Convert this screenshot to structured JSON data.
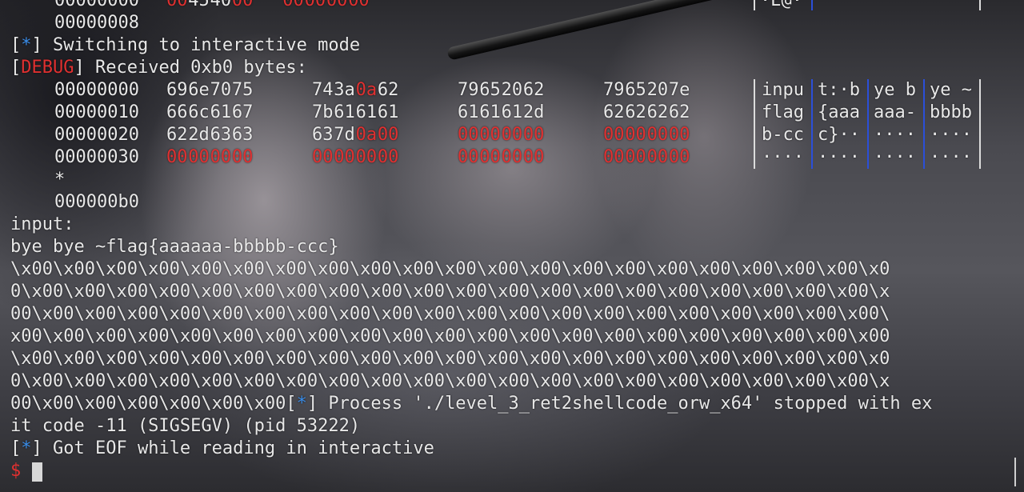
{
  "top_partial": {
    "hex_offset": "00000000",
    "hex_bytes": [
      "00",
      "45",
      "40",
      "00",
      "00",
      "00",
      "00",
      "00"
    ],
    "ascii": "·E@·",
    "next_offset": "00000008"
  },
  "lines": {
    "switching_marker": "*",
    "switching_text": " Switching to interactive mode",
    "debug_tag": "DEBUG",
    "received_text": " Received 0xb0 bytes:"
  },
  "hexdump": {
    "rows": [
      {
        "offset": "00000000",
        "groups": [
          [
            {
              "b": "69",
              "r": false
            },
            {
              "b": "6e",
              "r": false
            },
            {
              "b": "70",
              "r": false
            },
            {
              "b": "75",
              "r": false
            }
          ],
          [
            {
              "b": "74",
              "r": false
            },
            {
              "b": "3a",
              "r": false
            },
            {
              "b": "0a",
              "r": true
            },
            {
              "b": "62",
              "r": false
            }
          ],
          [
            {
              "b": "79",
              "r": false
            },
            {
              "b": "65",
              "r": false
            },
            {
              "b": "20",
              "r": false
            },
            {
              "b": "62",
              "r": false
            }
          ],
          [
            {
              "b": "79",
              "r": false
            },
            {
              "b": "65",
              "r": false
            },
            {
              "b": "20",
              "r": false
            },
            {
              "b": "7e",
              "r": false
            }
          ]
        ],
        "ascii": [
          "inpu",
          "t:·b",
          "ye b",
          "ye ~"
        ]
      },
      {
        "offset": "00000010",
        "groups": [
          [
            {
              "b": "66",
              "r": false
            },
            {
              "b": "6c",
              "r": false
            },
            {
              "b": "61",
              "r": false
            },
            {
              "b": "67",
              "r": false
            }
          ],
          [
            {
              "b": "7b",
              "r": false
            },
            {
              "b": "61",
              "r": false
            },
            {
              "b": "61",
              "r": false
            },
            {
              "b": "61",
              "r": false
            }
          ],
          [
            {
              "b": "61",
              "r": false
            },
            {
              "b": "61",
              "r": false
            },
            {
              "b": "61",
              "r": false
            },
            {
              "b": "2d",
              "r": false
            }
          ],
          [
            {
              "b": "62",
              "r": false
            },
            {
              "b": "62",
              "r": false
            },
            {
              "b": "62",
              "r": false
            },
            {
              "b": "62",
              "r": false
            }
          ]
        ],
        "ascii": [
          "flag",
          "{aaa",
          "aaa-",
          "bbbb"
        ]
      },
      {
        "offset": "00000020",
        "groups": [
          [
            {
              "b": "62",
              "r": false
            },
            {
              "b": "2d",
              "r": false
            },
            {
              "b": "63",
              "r": false
            },
            {
              "b": "63",
              "r": false
            }
          ],
          [
            {
              "b": "63",
              "r": false
            },
            {
              "b": "7d",
              "r": false
            },
            {
              "b": "0a",
              "r": true
            },
            {
              "b": "00",
              "r": true
            }
          ],
          [
            {
              "b": "00",
              "r": true
            },
            {
              "b": "00",
              "r": true
            },
            {
              "b": "00",
              "r": true
            },
            {
              "b": "00",
              "r": true
            }
          ],
          [
            {
              "b": "00",
              "r": true
            },
            {
              "b": "00",
              "r": true
            },
            {
              "b": "00",
              "r": true
            },
            {
              "b": "00",
              "r": true
            }
          ]
        ],
        "ascii": [
          "b-cc",
          "c}··",
          "····",
          "····"
        ]
      },
      {
        "offset": "00000030",
        "groups": [
          [
            {
              "b": "00",
              "r": true
            },
            {
              "b": "00",
              "r": true
            },
            {
              "b": "00",
              "r": true
            },
            {
              "b": "00",
              "r": true
            }
          ],
          [
            {
              "b": "00",
              "r": true
            },
            {
              "b": "00",
              "r": true
            },
            {
              "b": "00",
              "r": true
            },
            {
              "b": "00",
              "r": true
            }
          ],
          [
            {
              "b": "00",
              "r": true
            },
            {
              "b": "00",
              "r": true
            },
            {
              "b": "00",
              "r": true
            },
            {
              "b": "00",
              "r": true
            }
          ],
          [
            {
              "b": "00",
              "r": true
            },
            {
              "b": "00",
              "r": true
            },
            {
              "b": "00",
              "r": true
            },
            {
              "b": "00",
              "r": true
            }
          ]
        ],
        "ascii": [
          "····",
          "····",
          "····",
          "····"
        ]
      }
    ],
    "repeat_marker": "*",
    "end_offset": "000000b0"
  },
  "output": {
    "input_label": "input:",
    "bye_line": "bye bye ~flag{aaaaaa-bbbbb-ccc}",
    "wrapped_lines": [
      "\\x00\\x00\\x00\\x00\\x00\\x00\\x00\\x00\\x00\\x00\\x00\\x00\\x00\\x00\\x00\\x00\\x00\\x00\\x00\\x00\\x0",
      "0\\x00\\x00\\x00\\x00\\x00\\x00\\x00\\x00\\x00\\x00\\x00\\x00\\x00\\x00\\x00\\x00\\x00\\x00\\x00\\x00\\x",
      "00\\x00\\x00\\x00\\x00\\x00\\x00\\x00\\x00\\x00\\x00\\x00\\x00\\x00\\x00\\x00\\x00\\x00\\x00\\x00\\x00\\",
      "x00\\x00\\x00\\x00\\x00\\x00\\x00\\x00\\x00\\x00\\x00\\x00\\x00\\x00\\x00\\x00\\x00\\x00\\x00\\x00\\x00",
      "\\x00\\x00\\x00\\x00\\x00\\x00\\x00\\x00\\x00\\x00\\x00\\x00\\x00\\x00\\x00\\x00\\x00\\x00\\x00\\x00\\x0",
      "0\\x00\\x00\\x00\\x00\\x00\\x00\\x00\\x00\\x00\\x00\\x00\\x00\\x00\\x00\\x00\\x00\\x00\\x00\\x00\\x00\\x"
    ],
    "last_null_segment": "00\\x00\\x00\\x00\\x00\\x00\\x00",
    "process_marker": "*",
    "process_text": " Process './level_3_ret2shellcode_orw_x64' stopped with ex",
    "exit_line": "it code -11 (SIGSEGV) (pid 53222)",
    "eof_marker": "*",
    "eof_text": " Got EOF while reading in interactive",
    "prompt": "$"
  }
}
